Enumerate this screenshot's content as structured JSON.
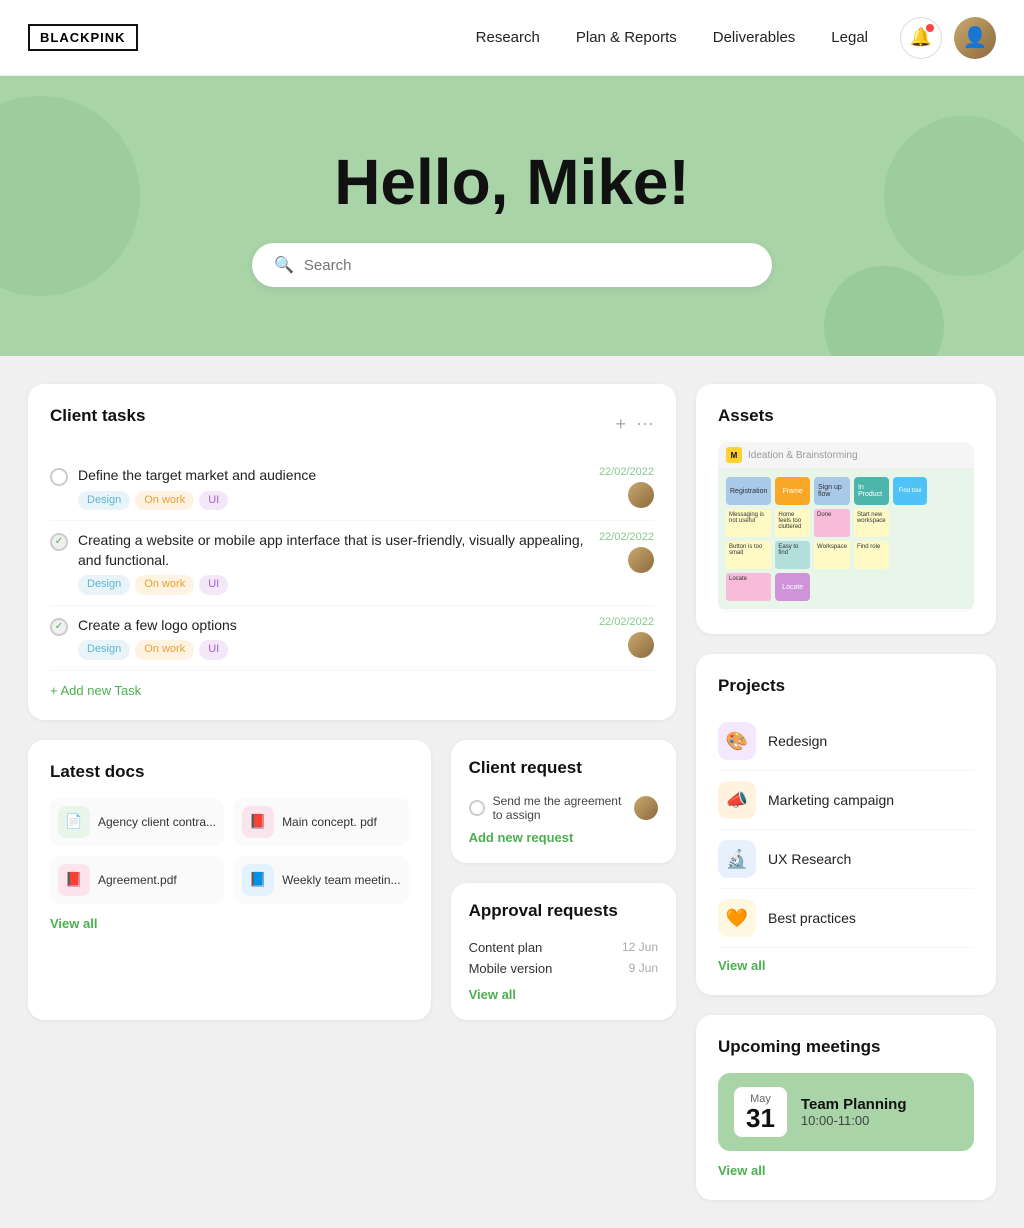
{
  "brand": {
    "logo": "BLACKPINK"
  },
  "navbar": {
    "links": [
      {
        "label": "Research",
        "id": "research"
      },
      {
        "label": "Plan & Reports",
        "id": "plan-reports"
      },
      {
        "label": "Deliverables",
        "id": "deliverables"
      },
      {
        "label": "Legal",
        "id": "legal"
      }
    ]
  },
  "hero": {
    "greeting": "Hello, Mike!",
    "search_placeholder": "Search"
  },
  "client_tasks": {
    "title": "Client tasks",
    "tasks": [
      {
        "text": "Define the target market and audience",
        "done": false,
        "tags": [
          "Design",
          "On work",
          "UI"
        ],
        "date": "22/02/2022"
      },
      {
        "text": "Creating a website or mobile app interface that is user-friendly, visually appealing, and functional.",
        "done": true,
        "tags": [
          "Design",
          "On work",
          "UI"
        ],
        "date": "22/02/2022"
      },
      {
        "text": "Create a few logo options",
        "done": true,
        "tags": [
          "Design",
          "On work",
          "UI"
        ],
        "date": "22/02/2022"
      }
    ],
    "add_label": "+ Add new Task"
  },
  "assets": {
    "title": "Assets"
  },
  "latest_docs": {
    "title": "Latest docs",
    "docs": [
      {
        "name": "Agency client contra...",
        "color": "green",
        "icon": "📄"
      },
      {
        "name": "Main concept. pdf",
        "color": "red",
        "icon": "📕"
      },
      {
        "name": "Agreement.pdf",
        "color": "red",
        "icon": "📕"
      },
      {
        "name": "Weekly team meetin...",
        "color": "blue",
        "icon": "📘"
      }
    ],
    "view_all": "View all"
  },
  "projects": {
    "title": "Projects",
    "items": [
      {
        "name": "Redesign",
        "icon": "🎨",
        "color": "#f3e8ff"
      },
      {
        "name": "Marketing campaign",
        "icon": "📣",
        "color": "#fff3e0"
      },
      {
        "name": "UX Research",
        "icon": "🔬",
        "color": "#e8f0fe"
      },
      {
        "name": "Best practices",
        "icon": "🧡",
        "color": "#fff8e1"
      }
    ],
    "view_all": "View all"
  },
  "upcoming_meetings": {
    "title": "Upcoming meetings",
    "meeting": {
      "month": "May",
      "day": "31",
      "name": "Team Planning",
      "time": "10:00-11:00"
    },
    "view_all": "View all"
  },
  "client_request": {
    "title": "Client request",
    "task": "Send me the agreement to assign",
    "add_label": "Add new request"
  },
  "approval_requests": {
    "title": "Approval requests",
    "items": [
      {
        "name": "Content plan",
        "date": "12 Jun"
      },
      {
        "name": "Mobile version",
        "date": "9 Jun"
      }
    ],
    "view_all": "View all"
  }
}
